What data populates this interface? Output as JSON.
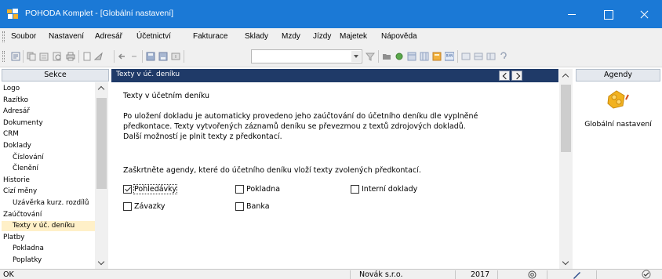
{
  "window": {
    "title": "POHODA Komplet - [Globální nastavení]",
    "controls": [
      "minimize-icon",
      "maximize-icon",
      "close-icon"
    ]
  },
  "menu": {
    "items": [
      "Soubor",
      "Nastavení",
      "Adresář",
      "Účetnictví",
      "Fakturace",
      "Sklady",
      "Mzdy",
      "Jízdy",
      "Majetek",
      "Nápověda"
    ]
  },
  "toolbar": {
    "icons": [
      "agenda-icon",
      "copy-icon",
      "new-record-icon",
      "preview-icon",
      "print-icon",
      "page-icon",
      "send-icon",
      "back-icon",
      "forward-icon",
      "save-icon",
      "save-all-icon",
      "sort-icon",
      "filter-icon",
      "folder-icon",
      "brush-icon",
      "calendar-icon",
      "table-icon",
      "calculator-icon",
      "ban-icon",
      "list-icon",
      "grid-icon",
      "form-icon",
      "help-icon"
    ],
    "combo_value": ""
  },
  "sidebar": {
    "header": "Sekce",
    "items": [
      {
        "label": "Logo",
        "indent": false,
        "selected": false
      },
      {
        "label": "Razítko",
        "indent": false,
        "selected": false
      },
      {
        "label": "Adresář",
        "indent": false,
        "selected": false
      },
      {
        "label": "Dokumenty",
        "indent": false,
        "selected": false
      },
      {
        "label": "CRM",
        "indent": false,
        "selected": false
      },
      {
        "label": "Doklady",
        "indent": false,
        "selected": false
      },
      {
        "label": "Číslování",
        "indent": true,
        "selected": false
      },
      {
        "label": "Členění",
        "indent": true,
        "selected": false
      },
      {
        "label": "Historie",
        "indent": false,
        "selected": false
      },
      {
        "label": "Cizí měny",
        "indent": false,
        "selected": false
      },
      {
        "label": "Uzávěrka kurz. rozdílů",
        "indent": true,
        "selected": false
      },
      {
        "label": "Zaúčtování",
        "indent": false,
        "selected": false
      },
      {
        "label": "Texty v úč. deníku",
        "indent": true,
        "selected": true
      },
      {
        "label": "Platby",
        "indent": false,
        "selected": false
      },
      {
        "label": "Pokladna",
        "indent": true,
        "selected": false
      },
      {
        "label": "Poplatky",
        "indent": true,
        "selected": false
      }
    ]
  },
  "content": {
    "tab_title": "Texty v úč. deníku",
    "heading": "Texty v účetním deníku",
    "description": [
      "Po uložení dokladu je automaticky provedeno jeho zaúčtování do účetního deníku dle vyplněné",
      "předkontace. Texty vytvořených záznamů deníku se převezmou z textů zdrojových dokladů.",
      "Další možností je plnit texty z předkontací."
    ],
    "instruction": "Zaškrtněte agendy, které do účetního deníku vloží texty zvolených předkontací.",
    "checkboxes": [
      {
        "label": "Pohledávky",
        "checked": true
      },
      {
        "label": "Pokladna",
        "checked": false
      },
      {
        "label": "Interní doklady",
        "checked": false
      },
      {
        "label": "Závazky",
        "checked": false
      },
      {
        "label": "Banka",
        "checked": false
      }
    ]
  },
  "agendas": {
    "header": "Agendy",
    "item": {
      "label": "Globální nastavení",
      "icon": "global-settings-icon"
    }
  },
  "status": {
    "state": "OK",
    "company": "Novák s.r.o.",
    "year": "2017",
    "icons": [
      "at-icon",
      "pen-icon",
      "check-circle-icon"
    ]
  },
  "colors": {
    "titlebar": "#1b79d6",
    "content_header": "#1f3a68",
    "selected_row": "#fff0c8",
    "panel_header": "#e4e8ee"
  }
}
